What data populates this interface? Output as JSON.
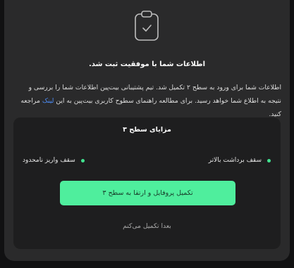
{
  "modal": {
    "icon": "clipboard-check-icon",
    "title": "اطلاعات شما با موفقیت ثبت شد.",
    "description_part1": "اطلاعات شما برای ورود به سطح ۲ تکمیل شد. تیم پشتیبانی بیت‌پین اطلاعات شما را بررسی و نتیجه به اطلاع شما خواهد رسید. برای مطالعه راهنمای سطوح کاربری بیت‌پین به این ",
    "description_link": "لینک",
    "description_part2": " مراجعه کنید."
  },
  "benefits_card": {
    "title": "مزایای سطح ۳",
    "items": [
      {
        "label": "سقف برداشت بالاتر"
      },
      {
        "label": "سقف واریز نامحدود"
      }
    ]
  },
  "actions": {
    "primary_label": "تکمیل پروفایل و ارتقا به سطح ۳",
    "secondary_label": "بعدا تکمیل می‌کنم"
  },
  "colors": {
    "accent": "#4fee9d",
    "link": "#4d8df7",
    "modal_bg": "#2a2a2b",
    "card_bg": "#1e1e1f"
  }
}
